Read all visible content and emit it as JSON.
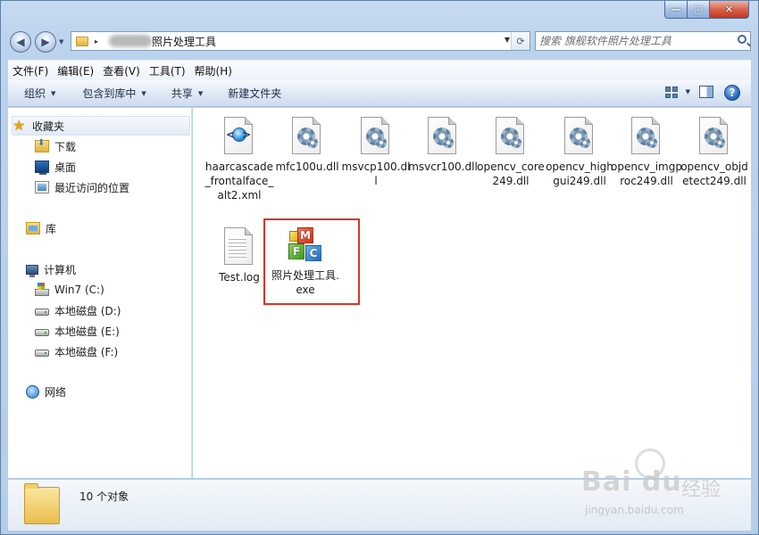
{
  "window": {
    "minimize_glyph": "—",
    "maximize_glyph": "□",
    "close_glyph": "✕"
  },
  "address": {
    "path_tail": "照片处理工具",
    "path_separator": "▸"
  },
  "search": {
    "placeholder": "搜索 旗舰软件照片处理工具"
  },
  "menu": [
    "文件(F)",
    "编辑(E)",
    "查看(V)",
    "工具(T)",
    "帮助(H)"
  ],
  "toolbar": {
    "organize": "组织",
    "include_in_library": "包含到库中",
    "share": "共享",
    "new_folder": "新建文件夹",
    "help_glyph": "?"
  },
  "nav": {
    "favorites": "收藏夹",
    "downloads": "下载",
    "desktop": "桌面",
    "recent": "最近访问的位置",
    "libraries": "库",
    "computer": "计算机",
    "drive_c": "Win7 (C:)",
    "drive_d": "本地磁盘 (D:)",
    "drive_e": "本地磁盘 (E:)",
    "drive_f": "本地磁盘 (F:)",
    "network": "网络"
  },
  "files": [
    {
      "name": "haarcascade_frontalface_alt2.xml",
      "icon": "xml-file-icon"
    },
    {
      "name": "mfc100u.dll",
      "icon": "dll-file-icon"
    },
    {
      "name": "msvcp100.dll",
      "icon": "dll-file-icon"
    },
    {
      "name": "msvcr100.dll",
      "icon": "dll-file-icon"
    },
    {
      "name": "opencv_core249.dll",
      "icon": "dll-file-icon"
    },
    {
      "name": "opencv_highgui249.dll",
      "icon": "dll-file-icon"
    },
    {
      "name": "opencv_imgproc249.dll",
      "icon": "dll-file-icon"
    },
    {
      "name": "opencv_objdetect249.dll",
      "icon": "dll-file-icon"
    },
    {
      "name": "Test.log",
      "icon": "text-file-icon"
    },
    {
      "name": "照片处理工具.exe",
      "icon": "mfc-app-icon",
      "highlighted": true
    }
  ],
  "details": {
    "count": "10 个对象"
  },
  "watermark": {
    "logo": "Bai du",
    "cn": "经验",
    "url": "jingyan.baidu.com"
  },
  "colors": {
    "highlight_border": "#d7352a",
    "window_frame": "#b4cde9"
  }
}
